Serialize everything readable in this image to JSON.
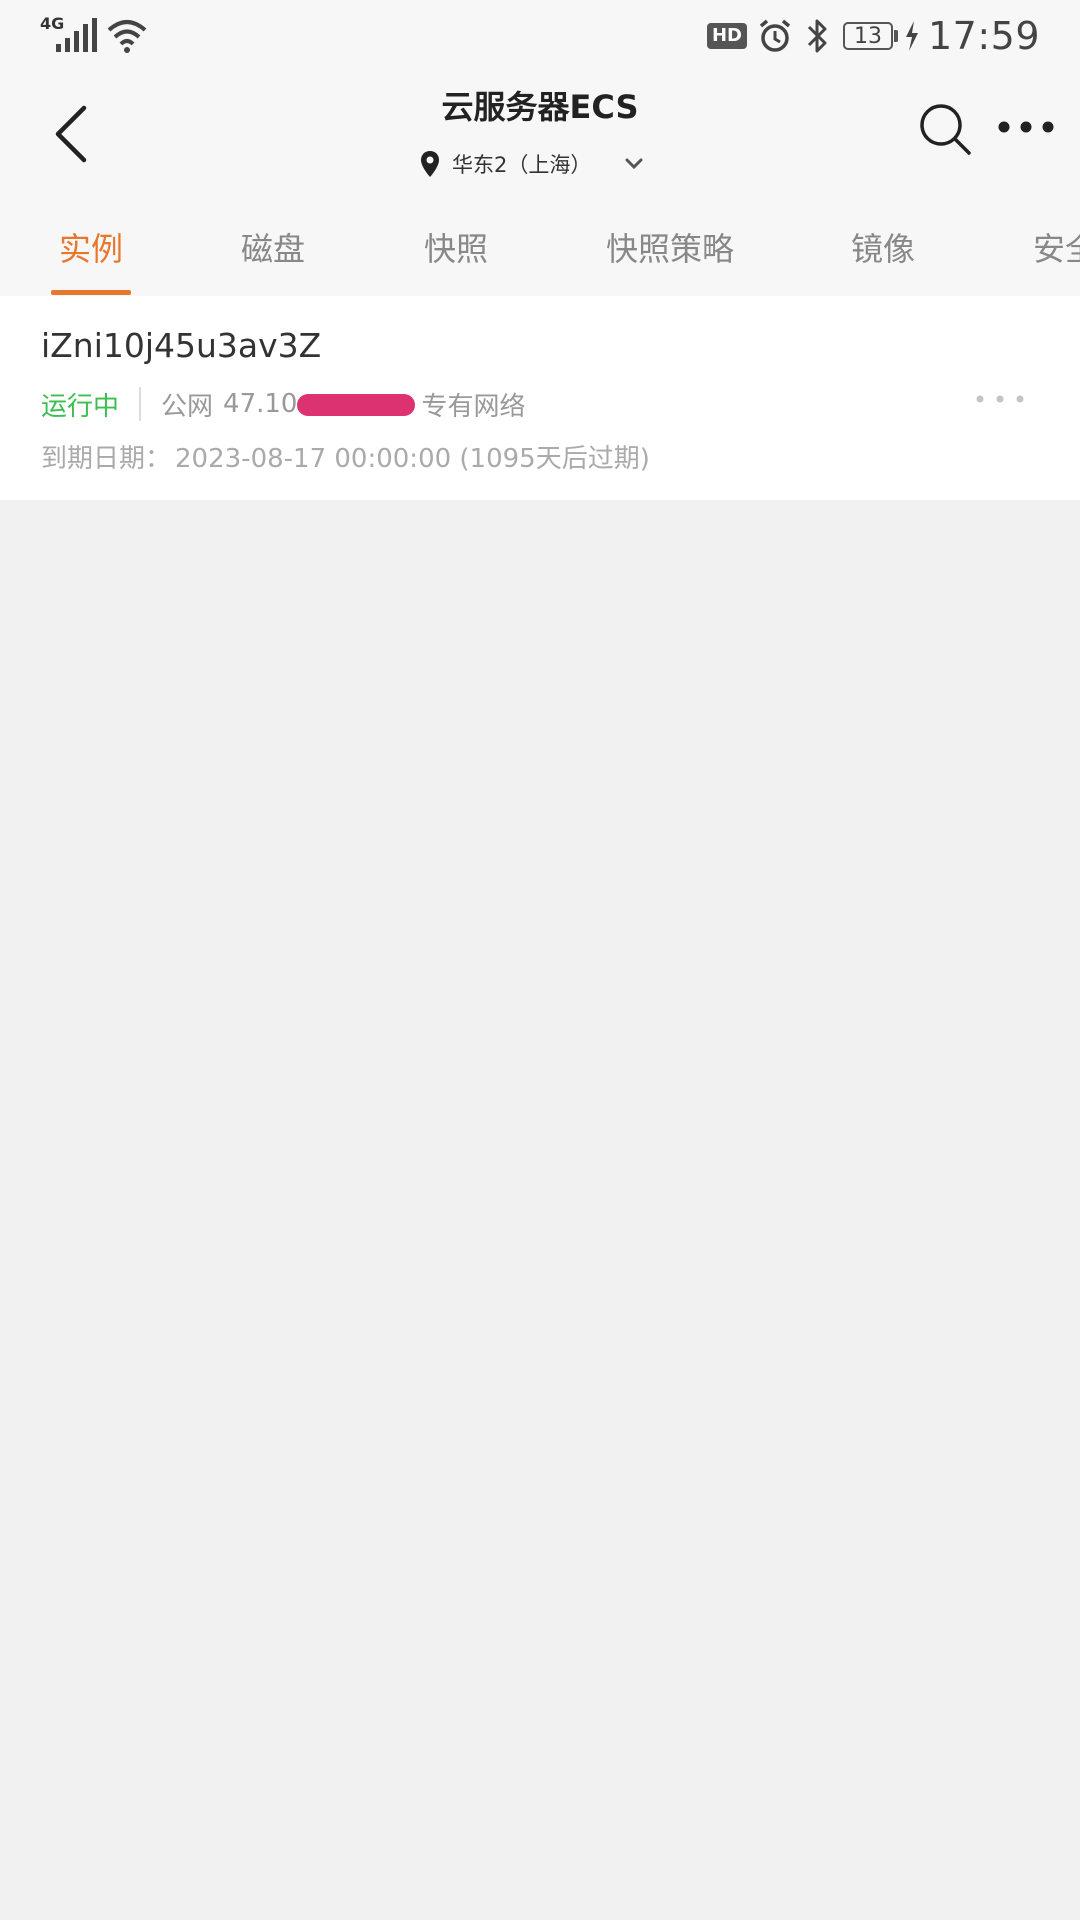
{
  "status_bar": {
    "network": "4G",
    "hd_badge": "HD",
    "battery_level": "13",
    "time": "17:59",
    "icons": [
      "signal-icon",
      "wifi-icon",
      "hd-icon",
      "alarm-icon",
      "bluetooth-icon",
      "battery-icon",
      "charging-icon"
    ]
  },
  "header": {
    "title": "云服务器ECS",
    "region": "华东2（上海）",
    "icons": [
      "back-arrow-icon",
      "location-pin-icon",
      "chevron-down-icon",
      "search-icon",
      "more-icon"
    ]
  },
  "tabs": [
    {
      "label": "实例",
      "active": true
    },
    {
      "label": "磁盘",
      "active": false
    },
    {
      "label": "快照",
      "active": false
    },
    {
      "label": "快照策略",
      "active": false
    },
    {
      "label": "镜像",
      "active": false
    },
    {
      "label": "安全",
      "active": false
    }
  ],
  "instance": {
    "name": "iZni10j45u3av3Z",
    "status": "运行中",
    "ip_label": "公网",
    "ip_value": "47.10",
    "network_type": "专有网络",
    "expire_label": "到期日期：",
    "expire_value": "2023-08-17 00:00:00 (1095天后过期)"
  },
  "colors": {
    "accent": "#e8772e",
    "running": "#3cbf51",
    "redaction": "#dc3272",
    "background": "#f1f1f1"
  }
}
